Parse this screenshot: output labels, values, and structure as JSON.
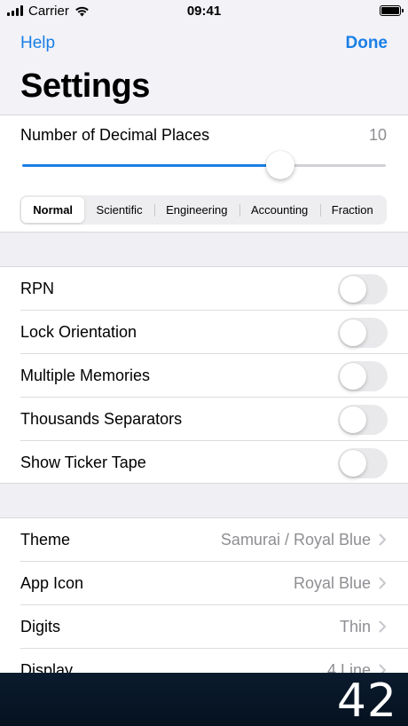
{
  "status_bar": {
    "carrier": "Carrier",
    "time": "09:41",
    "icons": [
      "cellular-signal-icon",
      "wifi-icon",
      "battery-icon"
    ]
  },
  "nav": {
    "left_button": "Help",
    "right_button": "Done",
    "title": "Settings"
  },
  "colors": {
    "accent": "#1a7fe6",
    "background": "#efeff4",
    "secondary_text": "#8e8e93",
    "display_background": "#081626"
  },
  "decimal_places": {
    "label": "Number of Decimal Places",
    "value": "10",
    "slider_fraction": 0.71
  },
  "number_format": {
    "options": [
      "Normal",
      "Scientific",
      "Engineering",
      "Accounting",
      "Fraction"
    ],
    "selected": "Normal"
  },
  "toggles": [
    {
      "label": "RPN",
      "on": false
    },
    {
      "label": "Lock Orientation",
      "on": false
    },
    {
      "label": "Multiple Memories",
      "on": false
    },
    {
      "label": "Thousands Separators",
      "on": false
    },
    {
      "label": "Show Ticker Tape",
      "on": false
    }
  ],
  "detail_rows": [
    {
      "label": "Theme",
      "value": "Samurai / Royal Blue"
    },
    {
      "label": "App Icon",
      "value": "Royal Blue"
    },
    {
      "label": "Digits",
      "value": "Thin"
    },
    {
      "label": "Display",
      "value": "4 Line"
    }
  ],
  "display": {
    "value": "42"
  }
}
